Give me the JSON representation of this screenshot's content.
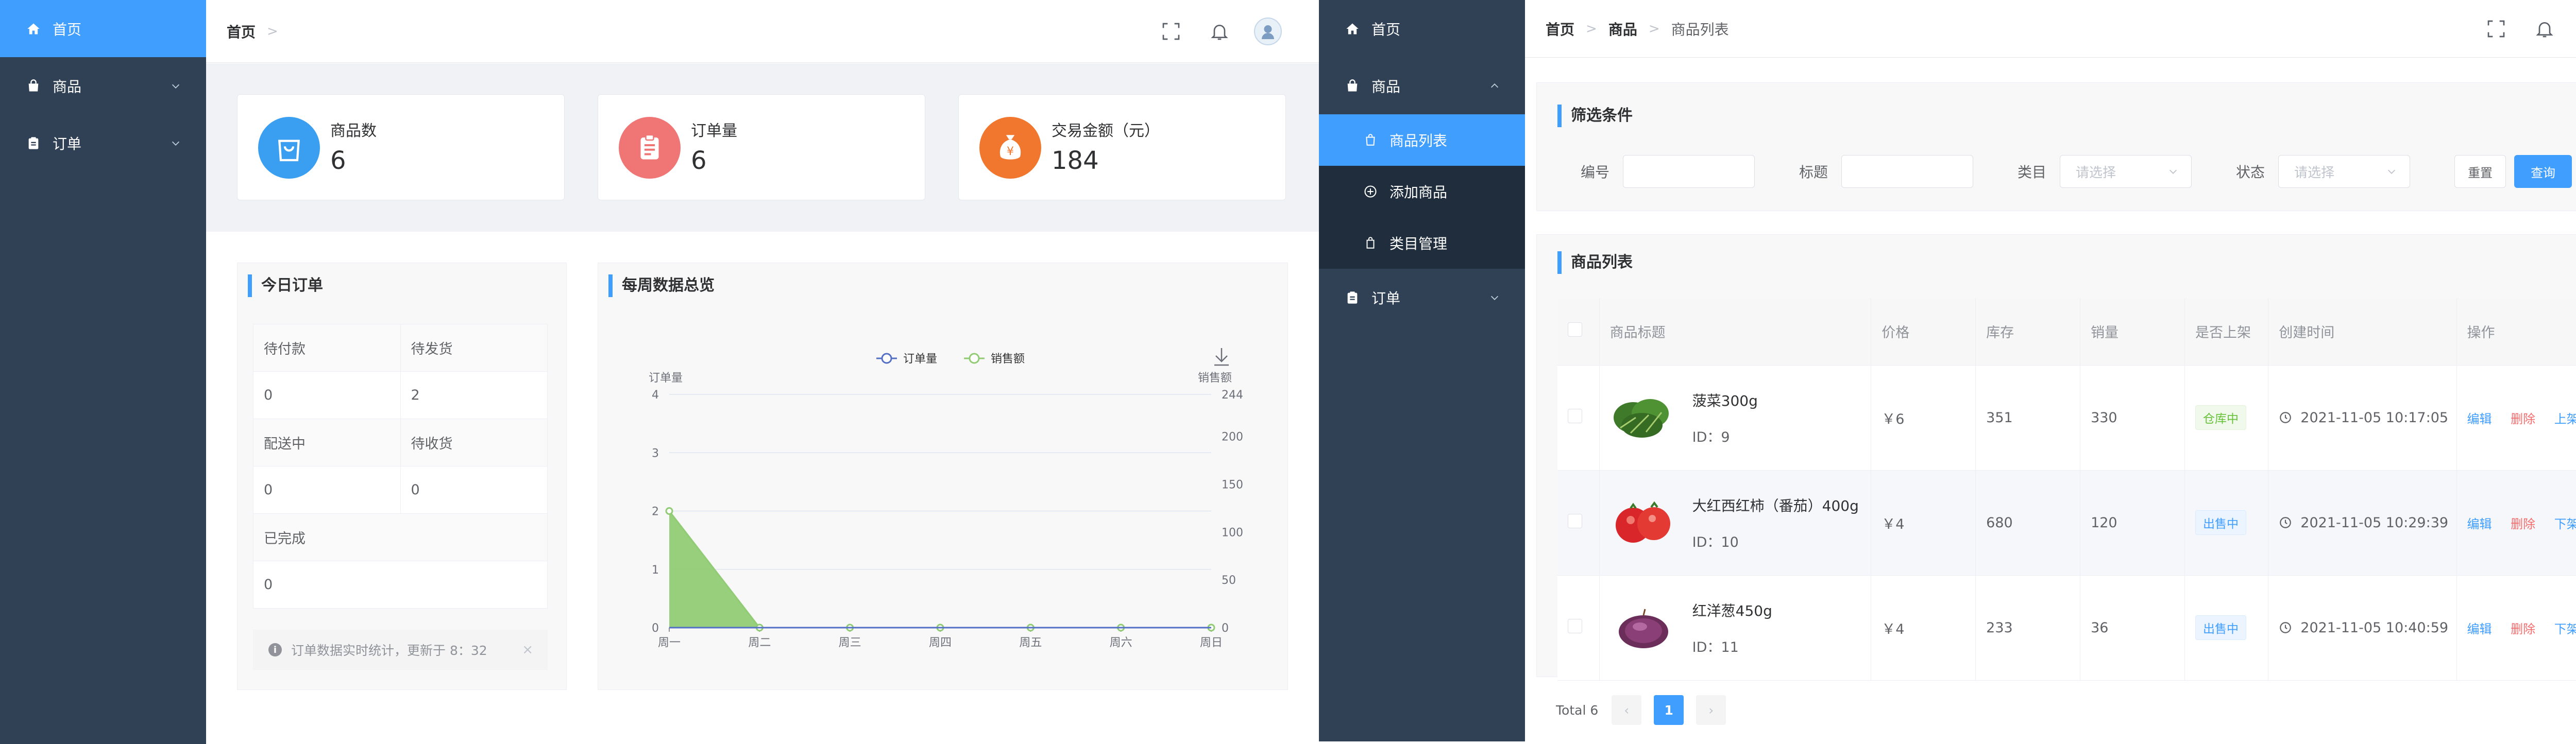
{
  "colors": {
    "sidebar": "#304156",
    "submenu": "#1f2d3d",
    "accent": "#409eff",
    "content_bg": "#f0f2f5",
    "card_blue": "#3a9ff1",
    "card_red": "#f07676",
    "card_orange": "#f0772d",
    "series_orders": "#5470c6",
    "series_sales": "#91cc75"
  },
  "screenA": {
    "sidebar": [
      {
        "label": "首页",
        "icon": "home-icon"
      },
      {
        "label": "商品",
        "icon": "bag-icon"
      },
      {
        "label": "订单",
        "icon": "clipboard-icon"
      }
    ],
    "breadcrumb": {
      "home": "首页",
      "sep": ">"
    },
    "stats": [
      {
        "label": "商品数",
        "value": "6",
        "icon": "shopping-bag-icon"
      },
      {
        "label": "订单量",
        "value": "6",
        "icon": "order-list-icon"
      },
      {
        "label": "交易金额（元）",
        "value": "184",
        "icon": "money-bag-icon",
        "icon_text": "¥"
      }
    ],
    "today_orders": {
      "title": "今日订单",
      "rows": [
        {
          "labels": [
            "待付款",
            "待发货"
          ],
          "values": [
            "0",
            "2"
          ]
        },
        {
          "labels": [
            "配送中",
            "待收货"
          ],
          "values": [
            "0",
            "0"
          ]
        },
        {
          "labels": [
            "已完成"
          ],
          "values": [
            "0"
          ]
        }
      ],
      "notice": "订单数据实时统计，更新于 8：32",
      "notice_close": "×",
      "notice_icon": "i"
    },
    "weekly": {
      "title": "每周数据总览"
    }
  },
  "chart_data": {
    "type": "line",
    "title": "",
    "legend": [
      "订单量",
      "销售额"
    ],
    "legend_position": "top-center",
    "categories": [
      "周一",
      "周二",
      "周三",
      "周四",
      "周五",
      "周六",
      "周日"
    ],
    "ylabel": "订单量",
    "ylabel_right": "销售额",
    "ylim": [
      0,
      4
    ],
    "yticks": [
      "0",
      "1",
      "2",
      "3",
      "4"
    ],
    "ylim_right": [
      0,
      244
    ],
    "yticks_right": [
      "0",
      "50",
      "100",
      "150",
      "200",
      "244"
    ],
    "grid": true,
    "series": [
      {
        "name": "订单量",
        "axis": "left",
        "values": [
          0,
          0,
          0,
          0,
          0,
          0,
          0
        ]
      },
      {
        "name": "销售额",
        "axis": "right",
        "area": true,
        "values": [
          122,
          0,
          0,
          0,
          0,
          0,
          0
        ]
      }
    ]
  },
  "screenB": {
    "sidebar": {
      "home": {
        "label": "首页",
        "icon": "home-icon"
      },
      "goods": {
        "label": "商品",
        "icon": "bag-icon"
      },
      "sub": [
        {
          "label": "商品列表",
          "icon": "shopping-bag-icon"
        },
        {
          "label": "添加商品",
          "icon": "plus-circle-icon"
        },
        {
          "label": "类目管理",
          "icon": "bag-outline-icon"
        }
      ],
      "orders": {
        "label": "订单",
        "icon": "clipboard-icon"
      }
    },
    "breadcrumb": {
      "home": "首页",
      "goods": "商品",
      "current": "商品列表",
      "sep": ">"
    },
    "filter": {
      "title": "筛选条件",
      "fields": {
        "id_label": "编号",
        "id_value": "",
        "title_label": "标题",
        "title_value": "",
        "category_label": "类目",
        "category_placeholder": "请选择",
        "status_label": "状态",
        "status_placeholder": "请选择"
      },
      "reset": "重置",
      "search": "查询"
    },
    "list": {
      "title": "商品列表",
      "columns": [
        "商品标题",
        "价格",
        "库存",
        "销量",
        "是否上架",
        "创建时间",
        "操作"
      ],
      "rows": [
        {
          "title": "菠菜300g",
          "id": "ID：9",
          "price": "￥6",
          "stock": "351",
          "sales": "330",
          "status": "仓库中",
          "status_type": "green",
          "created": "2021-11-05 10:17:05",
          "edit": "编辑",
          "delete": "删除",
          "shelf": "上架",
          "img": "spinach"
        },
        {
          "title": "大红西红柿（番茄）400g",
          "id": "ID：10",
          "price": "￥4",
          "stock": "680",
          "sales": "120",
          "status": "出售中",
          "status_type": "blue",
          "created": "2021-11-05 10:29:39",
          "edit": "编辑",
          "delete": "删除",
          "shelf": "下架",
          "img": "tomato"
        },
        {
          "title": "红洋葱450g",
          "id": "ID：11",
          "price": "￥4",
          "stock": "233",
          "sales": "36",
          "status": "出售中",
          "status_type": "blue",
          "created": "2021-11-05 10:40:59",
          "edit": "编辑",
          "delete": "删除",
          "shelf": "下架",
          "img": "onion"
        }
      ]
    },
    "pagination": {
      "total": "Total 6",
      "prev": "‹",
      "current": "1",
      "next": "›"
    }
  }
}
